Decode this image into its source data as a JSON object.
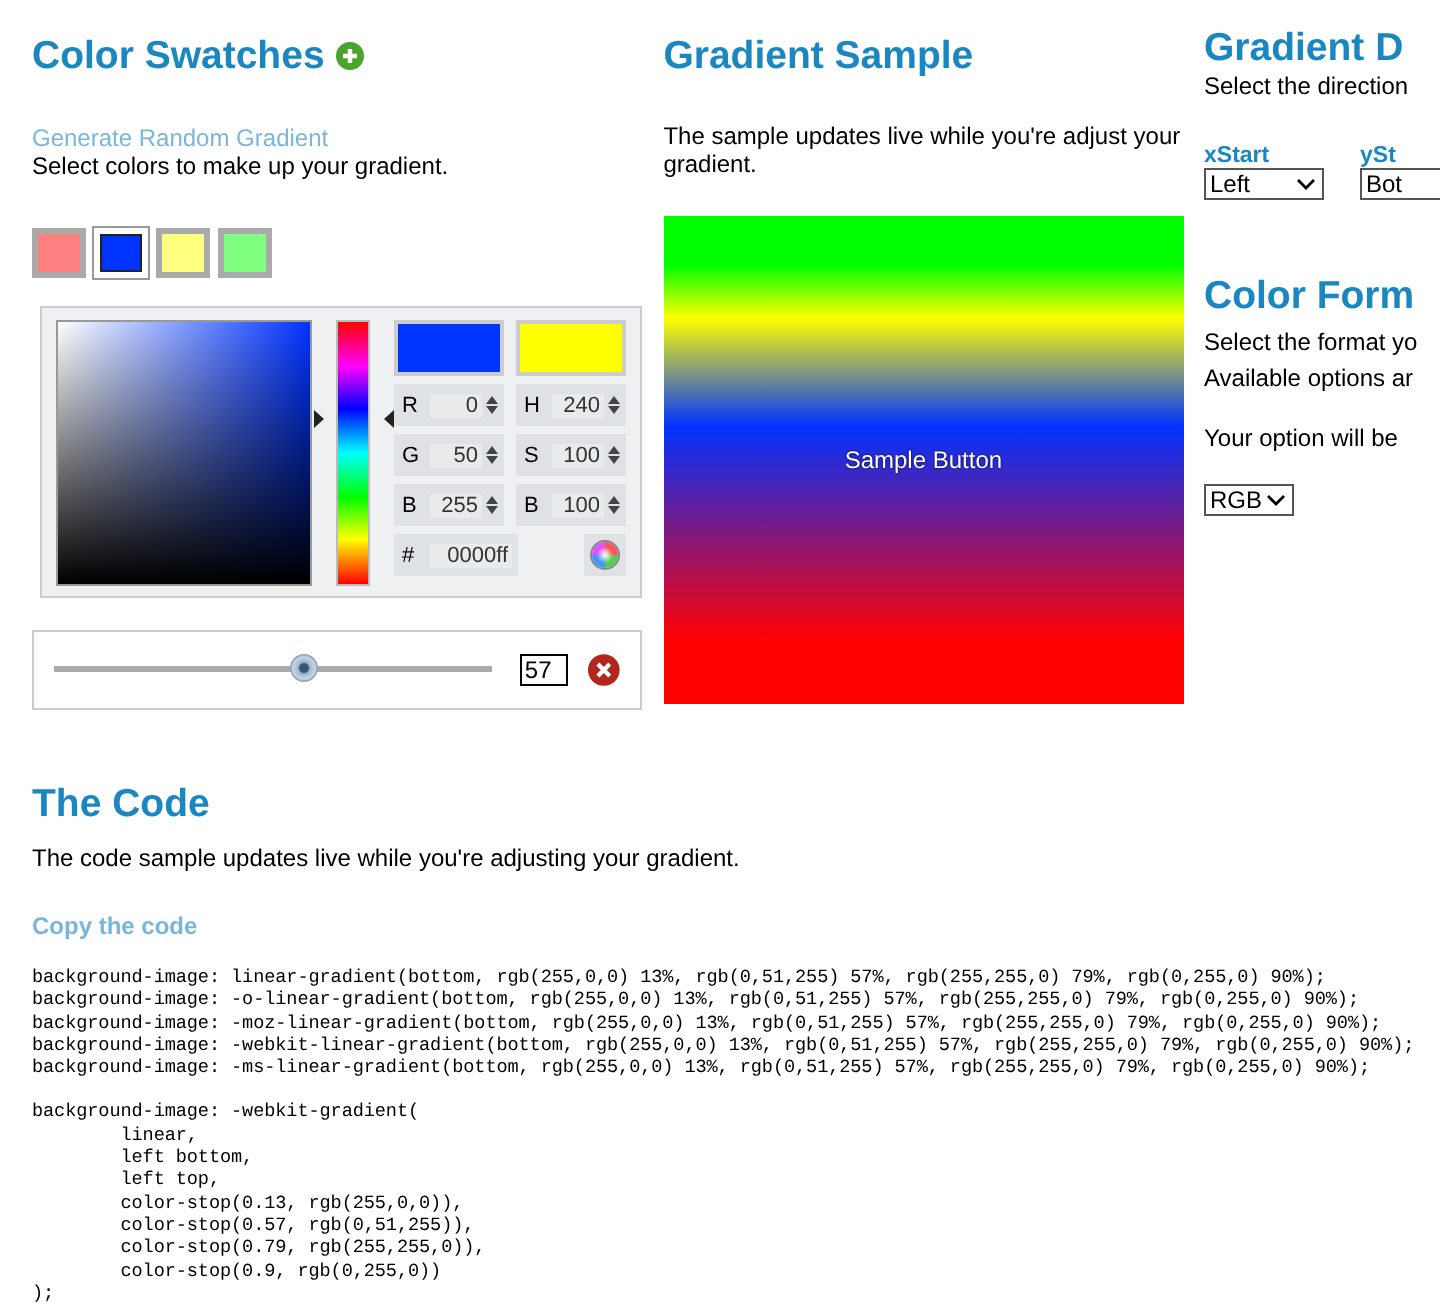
{
  "swatches_panel": {
    "title": "Color Swatches",
    "random_link": "Generate Random Gradient",
    "description": "Select colors to make up your gradient.",
    "swatches": [
      {
        "color": "#ff8080",
        "selected": false
      },
      {
        "color": "#0033ff",
        "selected": true
      },
      {
        "color": "#ffff80",
        "selected": false
      },
      {
        "color": "#80ff80",
        "selected": false
      }
    ],
    "picker": {
      "previews": [
        {
          "color": "#0033ff"
        },
        {
          "color": "#ffff00"
        }
      ],
      "fields": [
        {
          "label": "R",
          "value": "0"
        },
        {
          "label": "H",
          "value": "240"
        },
        {
          "label": "G",
          "value": "50"
        },
        {
          "label": "S",
          "value": "100"
        },
        {
          "label": "B",
          "value": "255"
        },
        {
          "label": "B",
          "value": "100"
        }
      ],
      "hex": {
        "label": "#",
        "value": "0000ff"
      }
    },
    "position_slider": {
      "level": 0.57,
      "value": "57"
    }
  },
  "sample_panel": {
    "title": "Gradient Sample",
    "description": "The sample updates live while you're adjust your gradient.",
    "button": "Sample Button"
  },
  "direction_panel": {
    "title": "Gradient D",
    "description": "Select the direction",
    "selects": [
      {
        "label": "xStart",
        "value": "Left"
      },
      {
        "label": "ySt",
        "value": "Bot"
      }
    ]
  },
  "format_panel": {
    "title": "Color Form",
    "lines": [
      "Select the format yo",
      "Available options ar",
      "Your option will be"
    ],
    "select": "RGB"
  },
  "code_panel": {
    "title": "The Code",
    "description": "The code sample updates live while you're adjusting your gradient.",
    "copy_link": "Copy the code",
    "lines": [
      "background-image: linear-gradient(bottom, rgb(255,0,0) 13%, rgb(0,51,255) 57%, rgb(255,255,0) 79%, rgb(0,255,0) 90%);",
      "background-image: -o-linear-gradient(bottom, rgb(255,0,0) 13%, rgb(0,51,255) 57%, rgb(255,255,0) 79%, rgb(0,255,0) 90%);",
      "background-image: -moz-linear-gradient(bottom, rgb(255,0,0) 13%, rgb(0,51,255) 57%, rgb(255,255,0) 79%, rgb(0,255,0) 90%);",
      "background-image: -webkit-linear-gradient(bottom, rgb(255,0,0) 13%, rgb(0,51,255) 57%, rgb(255,255,0) 79%, rgb(0,255,0) 90%);",
      "background-image: -ms-linear-gradient(bottom, rgb(255,0,0) 13%, rgb(0,51,255) 57%, rgb(255,255,0) 79%, rgb(0,255,0) 90%);"
    ],
    "webkit_lines": [
      "background-image: -webkit-gradient(",
      "        linear,",
      "        left bottom,",
      "        left top,",
      "        color-stop(0.13, rgb(255,0,0)),",
      "        color-stop(0.57, rgb(0,51,255)),",
      "        color-stop(0.79, rgb(255,255,0)),",
      "        color-stop(0.9, rgb(0,255,0))",
      ");"
    ]
  }
}
